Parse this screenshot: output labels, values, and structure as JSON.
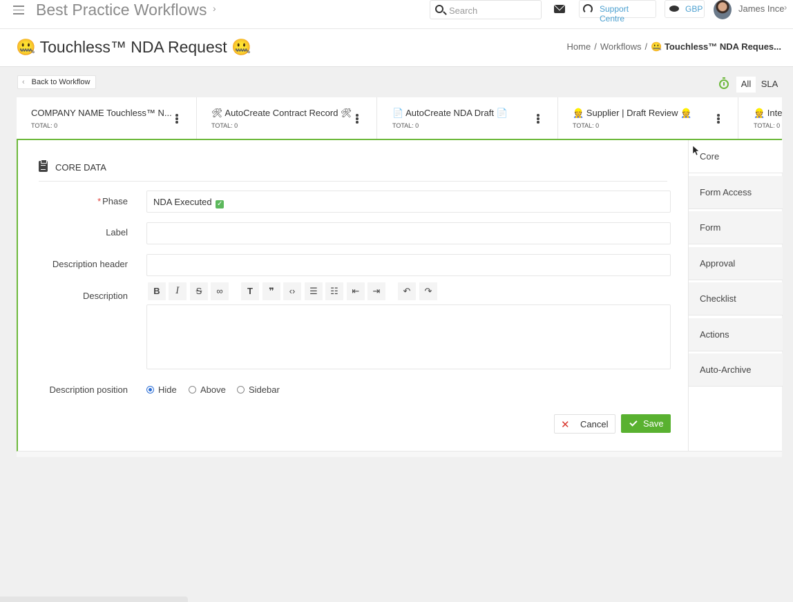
{
  "topbar": {
    "app_title": "Best Practice Workflows",
    "search_placeholder": "Search",
    "support_label": "Support Centre",
    "currency_label": "GBP",
    "user_name": "James Ince"
  },
  "titlebar": {
    "page_title": "🤐 Touchless™ NDA Request 🤐",
    "breadcrumb": [
      "Home",
      "Workflows",
      "🤐 Touchless™ NDA Reques..."
    ],
    "separator": "/"
  },
  "back_button": "Back to Workflow",
  "view_tabs": [
    "All",
    "SLA"
  ],
  "phases": [
    {
      "name": "COMPANY NAME Touchless™ N...",
      "total": "TOTAL: 0"
    },
    {
      "name": "🛠 AutoCreate Contract Record 🛠",
      "total": "TOTAL: 0"
    },
    {
      "name": "📄 AutoCreate NDA Draft 📄",
      "total": "TOTAL: 0"
    },
    {
      "name": "👷 Supplier | Draft Review 👷",
      "total": "TOTAL: 0"
    },
    {
      "name": "👷 Inter",
      "total": "TOTAL: 0"
    }
  ],
  "form": {
    "section_title": "CORE DATA",
    "phase_label": "Phase",
    "phase_value": "NDA Executed",
    "phase_check": "✓",
    "label_label": "Label",
    "label_value": "",
    "desc_header_label": "Description header",
    "desc_header_value": "",
    "description_label": "Description",
    "description_value": "",
    "position_label": "Description position",
    "position_options": [
      "Hide",
      "Above",
      "Sidebar"
    ],
    "position_selected": "Hide",
    "cancel_label": "Cancel",
    "save_label": "Save"
  },
  "side_tabs": [
    "Core",
    "Form Access",
    "Form",
    "Approval",
    "Checklist",
    "Actions",
    "Auto-Archive"
  ],
  "active_side_tab": "Core",
  "colors": {
    "accent_green": "#6cb83a",
    "link_blue": "#4a9fcf",
    "danger_red": "#d9382f"
  }
}
